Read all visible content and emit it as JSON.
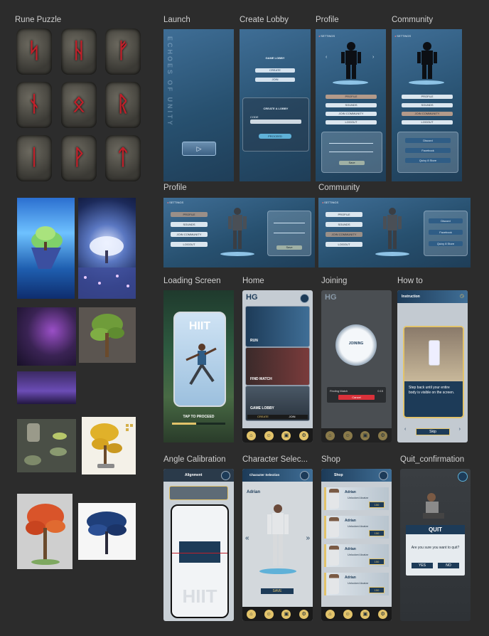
{
  "sections": {
    "rune_puzzle": "Rune Puzzle",
    "launch": "Launch",
    "create_lobby": "Create Lobby",
    "profile": "Profile",
    "community": "Community",
    "profile_wide": "Profile",
    "community_wide": "Community",
    "loading_screen": "Loading Screen",
    "home": "Home",
    "joining": "Joining",
    "how_to": "How to",
    "angle_calibration": "Angle Calibration",
    "character_selection": "Character Selec...",
    "shop": "Shop",
    "quit_confirmation": "Quit_confirmation"
  },
  "runes": [
    "ᛋ",
    "ᚺ",
    "ᚠ",
    "ᚾ",
    "ᛟ",
    "ᚱ",
    "ᛁ",
    "ᚹ",
    "ᛏ"
  ],
  "launch": {
    "vertical_title": "ECHOES OF UNITY"
  },
  "create_lobby": {
    "game_lobby": "GAME LOBBY",
    "create_btn": "CREATE",
    "join_btn": "JOIN",
    "panel_title": "CREATE A LOBBY",
    "code_label": "CODE",
    "proceed": "PROCEED"
  },
  "profile": {
    "settings": "SETTINGS",
    "menu": [
      "PROFILE",
      "SOUNDS",
      "JOIN COMMUNITY",
      "LOGOUT"
    ],
    "save": "Save"
  },
  "community": {
    "settings": "SETTINGS",
    "links": [
      "Discord",
      "Facebook",
      "Quixy 8 Store"
    ]
  },
  "loading": {
    "logo": "HIIT",
    "tap": "TAP TO PROCEED"
  },
  "home": {
    "logo": "HG",
    "cards": [
      "RUN",
      "FIND MATCH",
      "GAME LOBBY"
    ],
    "lobby_create": "CREATE",
    "lobby_join": "JOIN"
  },
  "joining": {
    "logo": "HG",
    "status": "JOINING",
    "finding": "Finding Match",
    "timer": "0:15",
    "cancel": "Cancel"
  },
  "howto": {
    "title": "Instruction",
    "text": "Step back until your entire body is visible on the screen.",
    "skip": "Skip"
  },
  "calibration": {
    "title": "Alignment",
    "logo": "HIIT"
  },
  "character": {
    "title": "Character Selection",
    "name": "Adrian",
    "save": "SAVE"
  },
  "shop": {
    "title": "Shop",
    "item_name": "Adrian",
    "item_desc": "Unlocked Avatar",
    "price": "150"
  },
  "quit": {
    "title": "QUIT",
    "question": "Are you sure you want to quit?",
    "yes": "YES",
    "no": "NO"
  },
  "colors": {
    "bg": "#2c2c2c",
    "accent": "#e2c36a",
    "rune_red": "#c0202a",
    "blue_ui": "#2f5d86"
  }
}
